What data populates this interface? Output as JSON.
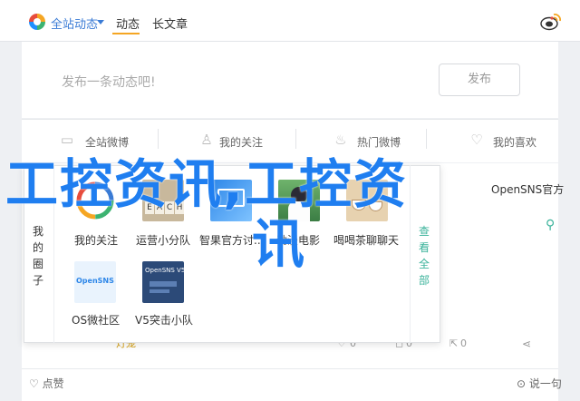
{
  "topbar": {
    "site_filter": "全站动态",
    "tabs": [
      {
        "label": "动态",
        "active": true
      },
      {
        "label": "长文章",
        "active": false
      }
    ]
  },
  "composer": {
    "placeholder": "发布一条动态吧!",
    "publish_label": "发布"
  },
  "filter_tabs": [
    {
      "label": "全站微博",
      "icon": "chat-icon"
    },
    {
      "label": "我的关注",
      "icon": "user-icon"
    },
    {
      "label": "热门微博",
      "icon": "fire-icon"
    },
    {
      "label": "我的喜欢",
      "icon": "heart-icon"
    }
  ],
  "circles_popup": {
    "side_label": "我的圈子",
    "view_all_label": "查看全部",
    "circles": [
      {
        "name": "我的关注",
        "thumb": "circle-logo"
      },
      {
        "name": "运营小分队",
        "thumb": "teach-letters",
        "thumb_text": "EACH"
      },
      {
        "name": "智果官方讨...",
        "thumb": "blue-screen"
      },
      {
        "name": "动漫电影",
        "thumb": "anime-girl"
      },
      {
        "name": "喝喝茶聊聊天",
        "thumb": "tea-cups"
      },
      {
        "name": "OS微社区",
        "thumb": "opensns-logo",
        "thumb_text": "OpenSNS"
      },
      {
        "name": "V5突击小队",
        "thumb": "opensns-v5",
        "thumb_text": "OpenSNS V5"
      }
    ]
  },
  "feed": {
    "author": "OpenSNS官方",
    "tag": "灯笼",
    "like_count": "0",
    "comment_count": "0",
    "repost_count": "0",
    "like_label": "点赞",
    "say_label": "说一句"
  },
  "watermark": {
    "line1": "工控资讯,工控资",
    "line2": "讯"
  },
  "colors": {
    "accent": "#3a7bd5",
    "tab_underline": "#f5a623",
    "watermark": "#1f7ef0",
    "view_all": "#3bb39b"
  }
}
